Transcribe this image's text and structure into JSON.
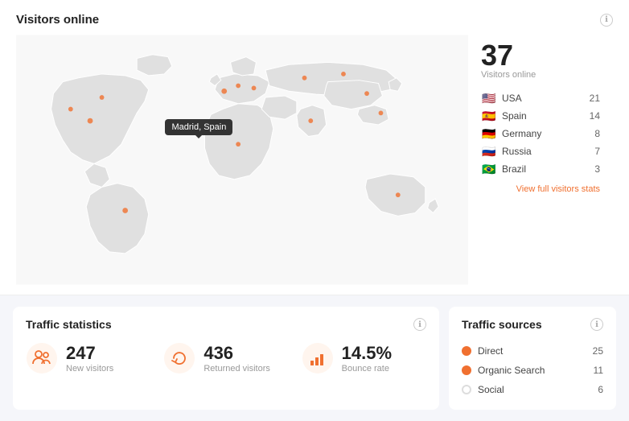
{
  "visitorsOnline": {
    "title": "Visitors online",
    "count": "37",
    "countLabel": "Visitors online",
    "tooltip": "Madrid, Spain",
    "countries": [
      {
        "flag": "🇺🇸",
        "name": "USA",
        "count": 21
      },
      {
        "flag": "🇪🇸",
        "name": "Spain",
        "count": 14
      },
      {
        "flag": "🇩🇪",
        "name": "Germany",
        "count": 8
      },
      {
        "flag": "🇷🇺",
        "name": "Russia",
        "count": 7
      },
      {
        "flag": "🇧🇷",
        "name": "Brazil",
        "count": 3
      }
    ],
    "viewFullLink": "View full visitors stats"
  },
  "trafficStats": {
    "title": "Traffic statistics",
    "stats": [
      {
        "id": "new-visitors",
        "value": "247",
        "label": "New visitors",
        "iconType": "people"
      },
      {
        "id": "returned-visitors",
        "value": "436",
        "label": "Returned visitors",
        "iconType": "refresh"
      },
      {
        "id": "bounce-rate",
        "value": "14.5%",
        "label": "Bounce rate",
        "iconType": "bars"
      }
    ]
  },
  "trafficSources": {
    "title": "Traffic sources",
    "sources": [
      {
        "name": "Direct",
        "count": 25,
        "color": "#f07030",
        "filled": true
      },
      {
        "name": "Organic Search",
        "count": 11,
        "color": "#f07030",
        "filled": true
      },
      {
        "name": "Social",
        "count": 6,
        "color": "#ddd",
        "filled": false
      }
    ]
  },
  "icons": {
    "info": "ℹ"
  }
}
